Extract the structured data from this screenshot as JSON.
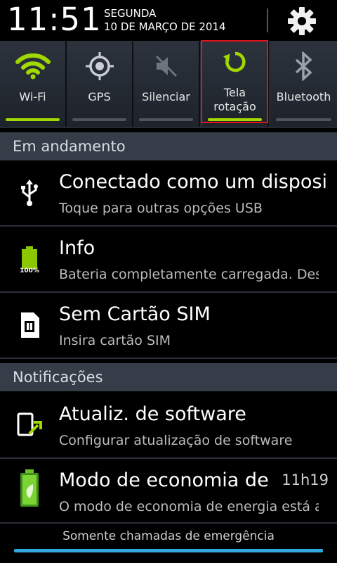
{
  "header": {
    "time": "11:51",
    "weekday": "SEGUNDA",
    "date": "10 DE MARÇO DE 2014"
  },
  "quick_settings": [
    {
      "label": "Wi-Fi",
      "icon": "wifi-icon",
      "active": true
    },
    {
      "label": "GPS",
      "icon": "gps-icon",
      "active": false
    },
    {
      "label": "Silenciar",
      "icon": "mute-icon",
      "active": false
    },
    {
      "label": "Tela rotação",
      "label_line1": "Tela",
      "label_line2": "rotação",
      "icon": "rotate-icon",
      "active": true
    },
    {
      "label": "Bluetooth",
      "icon": "bluetooth-icon",
      "active": false
    }
  ],
  "sections": {
    "ongoing": "Em andamento",
    "notifications": "Notificações"
  },
  "ongoing": [
    {
      "title": "Conectado como um dispositivo de mídia",
      "subtitle": "Toque para outras opções USB",
      "icon": "usb-icon"
    },
    {
      "title": "Info",
      "subtitle": "Bateria completamente carregada. Desconecte o carregador.",
      "icon": "battery-full-icon",
      "badge": "100%"
    },
    {
      "title": "Sem Cartão SIM",
      "subtitle": "Insira cartão SIM",
      "icon": "sim-card-icon"
    }
  ],
  "notifications": [
    {
      "title": "Atualiz. de software",
      "subtitle": "Configurar atualização de software",
      "icon": "software-update-icon"
    },
    {
      "title": "Modo de economia de energia",
      "subtitle": "O modo de economia de energia está ativado",
      "icon": "power-saving-icon",
      "time": "11h19"
    }
  ],
  "footer": {
    "emergency": "Somente chamadas de emergência"
  },
  "colors": {
    "accent_green": "#a0d800",
    "highlight_red": "#e0141e",
    "footer_blue": "#2fa8e0"
  }
}
